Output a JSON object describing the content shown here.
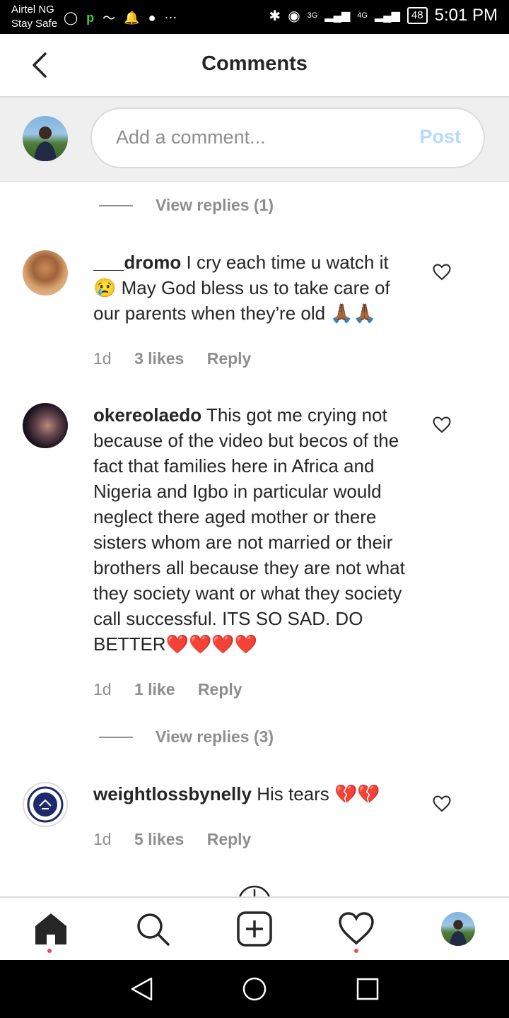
{
  "status_bar": {
    "carrier": "Airtel NG",
    "carrier_sub": "Stay Safe",
    "network_1": "3G",
    "network_2": "4G",
    "battery": "48",
    "time": "5:01 PM"
  },
  "header": {
    "title": "Comments"
  },
  "comment_input": {
    "placeholder": "Add a comment...",
    "post_label": "Post"
  },
  "replies_top": {
    "label": "View replies (1)"
  },
  "comments": [
    {
      "username": "___dromo",
      "text": "I cry each time u watch it 😢 May God bless us to take care of our parents when they’re old 🙏🏾🙏🏾",
      "time": "1d",
      "likes": "3 likes",
      "reply": "Reply"
    },
    {
      "username": "okereolaedo",
      "text": "This got me crying not because of the video but becos of the fact that families here in Africa and Nigeria and Igbo in particular would neglect there aged mother or there sisters whom are not married or their brothers all because they are not what they society want or what they society call successful. ITS SO SAD. DO BETTER❤️❤️❤️❤️",
      "time": "1d",
      "likes": "1 like",
      "reply": "Reply",
      "view_replies": "View replies (3)"
    },
    {
      "username": "weightlossbynelly",
      "text": "His tears 💔💔",
      "time": "1d",
      "likes": "5 likes",
      "reply": "Reply"
    }
  ],
  "colors": {
    "post_disabled": "#b3dbff",
    "muted": "#8e8e8e",
    "notification_dot": "#ed4956"
  }
}
